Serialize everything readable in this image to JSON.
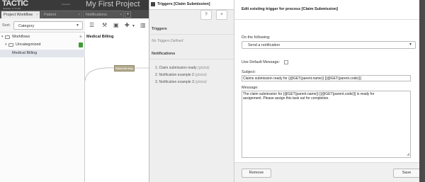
{
  "app": {
    "logo": "TACTIC",
    "logo_sub": "Release: 4.7.0.v06",
    "logo_small": "Workflow",
    "project_title": "My First Project"
  },
  "tabs": [
    {
      "label": "Project Workflow"
    },
    {
      "label": "Patient"
    },
    {
      "label": "Notifications"
    }
  ],
  "tab_add": "+",
  "sort": {
    "label": "Sort:",
    "value": "Category"
  },
  "tree": {
    "root": "Workflows",
    "uncategorized": "Uncategorized",
    "selected": "Medical Billing",
    "plus": "+"
  },
  "canvas": {
    "tab": "Medical Billing",
    "node": "Patient file entry"
  },
  "triggers": {
    "title": "Triggers [Claim Submission]",
    "help": "?",
    "add": "+",
    "section_triggers": "Triggers",
    "no_triggers": "No Triggers Defined",
    "section_notifications": "Notifications",
    "notifications": [
      {
        "label": "1. Claim submission ready",
        "tag": "(global)"
      },
      {
        "label": "2. Notification example 2",
        "tag": "(global)"
      },
      {
        "label": "3. Notification example 3",
        "tag": "(global)"
      }
    ]
  },
  "edit": {
    "title": "Edit existing trigger for process [Claim Submission]",
    "do_label": "Do the following:",
    "action_value": "Send a notification",
    "default_msg_label": "Use Default Message:",
    "subject_label": "Subject:",
    "subject_value": "Claims submission ready for {@GET(parent.name)}  [{@GET(parent.code)}]",
    "message_label": "Message:",
    "message_value": "The claim submission for {@GET(parent.name)}  [{@GET(parent.code)}] is ready for assignment. Please assign this task out for completion.",
    "remove_label": "Remove",
    "save_label": "Save"
  }
}
